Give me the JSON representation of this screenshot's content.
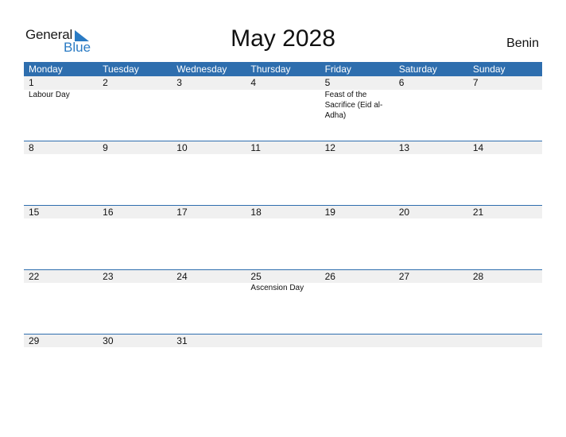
{
  "logo": {
    "word1": "General",
    "word2": "Blue",
    "accent_color": "#2a7bc4"
  },
  "title": "May 2028",
  "country": "Benin",
  "colors": {
    "header_bg": "#2e6eae",
    "date_row_bg": "#f0f0f0"
  },
  "weekdays": [
    "Monday",
    "Tuesday",
    "Wednesday",
    "Thursday",
    "Friday",
    "Saturday",
    "Sunday"
  ],
  "weeks": [
    {
      "days": [
        "1",
        "2",
        "3",
        "4",
        "5",
        "6",
        "7"
      ],
      "events": [
        "Labour Day",
        "",
        "",
        "",
        "Feast of the Sacrifice (Eid al-Adha)",
        "",
        ""
      ]
    },
    {
      "days": [
        "8",
        "9",
        "10",
        "11",
        "12",
        "13",
        "14"
      ],
      "events": [
        "",
        "",
        "",
        "",
        "",
        "",
        ""
      ]
    },
    {
      "days": [
        "15",
        "16",
        "17",
        "18",
        "19",
        "20",
        "21"
      ],
      "events": [
        "",
        "",
        "",
        "",
        "",
        "",
        ""
      ]
    },
    {
      "days": [
        "22",
        "23",
        "24",
        "25",
        "26",
        "27",
        "28"
      ],
      "events": [
        "",
        "",
        "",
        "Ascension Day",
        "",
        "",
        ""
      ]
    },
    {
      "days": [
        "29",
        "30",
        "31",
        "",
        "",
        "",
        ""
      ],
      "events": [
        "",
        "",
        "",
        "",
        "",
        "",
        ""
      ]
    }
  ]
}
